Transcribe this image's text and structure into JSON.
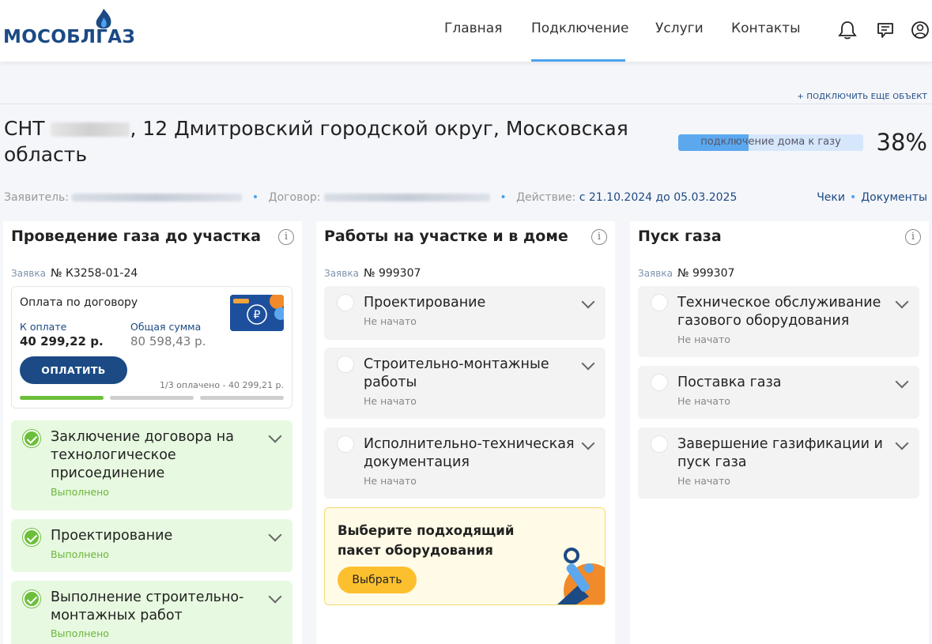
{
  "header": {
    "logo": "МОСОБЛГАЗ",
    "nav": [
      {
        "label": "Главная"
      },
      {
        "label": "Подключение"
      },
      {
        "label": "Услуги"
      },
      {
        "label": "Контакты"
      }
    ],
    "icons": [
      "bell-icon",
      "chat-icon",
      "user-icon"
    ]
  },
  "object": {
    "connect_more": "+ ПОДКЛЮЧИТЬ ЕЩЕ ОБЪЕКТ",
    "title_prefix": "СНТ",
    "title_rest": ", 12 Дмитровский городской округ, Московская область",
    "progress_label": "подключение дома к газу",
    "progress_fraction": 0.38,
    "progress_pct": "38%",
    "applicant_label": "Заявитель:",
    "contract_label": "Договор:",
    "action_label": "Действие:",
    "action_value": "с 21.10.2024 до 05.03.2025",
    "links": [
      "Чеки",
      "Документы"
    ]
  },
  "columns": [
    {
      "title": "Проведение газа до участка",
      "request_label": "Заявка",
      "request_number": "№ К3258-01-24",
      "payment": {
        "title": "Оплата по договору",
        "due_label": "К оплате",
        "due_value": "40 299,22 р.",
        "total_label": "Общая сумма",
        "total_value": "80 598,43 р.",
        "button": "ОПЛАТИТЬ",
        "paid_text": "1/3 оплачено - 40 299,21 р.",
        "installments_paid": 1,
        "installments_total": 3
      },
      "steps": [
        {
          "title": "Заключение договора на технологическое присоединение",
          "status": "Выполнено"
        },
        {
          "title": "Проектирование",
          "status": "Выполнено"
        },
        {
          "title": "Выполнение строительно-монтажных работ",
          "status": "Выполнено"
        }
      ]
    },
    {
      "title": "Работы на участке и в доме",
      "request_label": "Заявка",
      "request_number": "№ 999307",
      "steps": [
        {
          "title": "Проектирование",
          "status": "Не начато"
        },
        {
          "title": "Строительно-монтажные работы",
          "status": "Не начато"
        },
        {
          "title": "Исполнительно-техническая документация",
          "status": "Не начато"
        }
      ],
      "promo": {
        "title": "Выберите подходящий пакет оборудования",
        "button": "Выбрать"
      }
    },
    {
      "title": "Пуск газа",
      "request_label": "Заявка",
      "request_number": "№ 999307",
      "steps": [
        {
          "title": "Техническое обслуживание газового оборудования",
          "status": "Не начато"
        },
        {
          "title": "Поставка газа",
          "status": "Не начато"
        },
        {
          "title": "Завершение газификации и пуск газа",
          "status": "Не начато"
        }
      ]
    }
  ],
  "colors": {
    "brand": "#1b4a84",
    "accent": "#4aa3ef",
    "done": "#6cbf3a",
    "promo": "#fcc02f"
  }
}
